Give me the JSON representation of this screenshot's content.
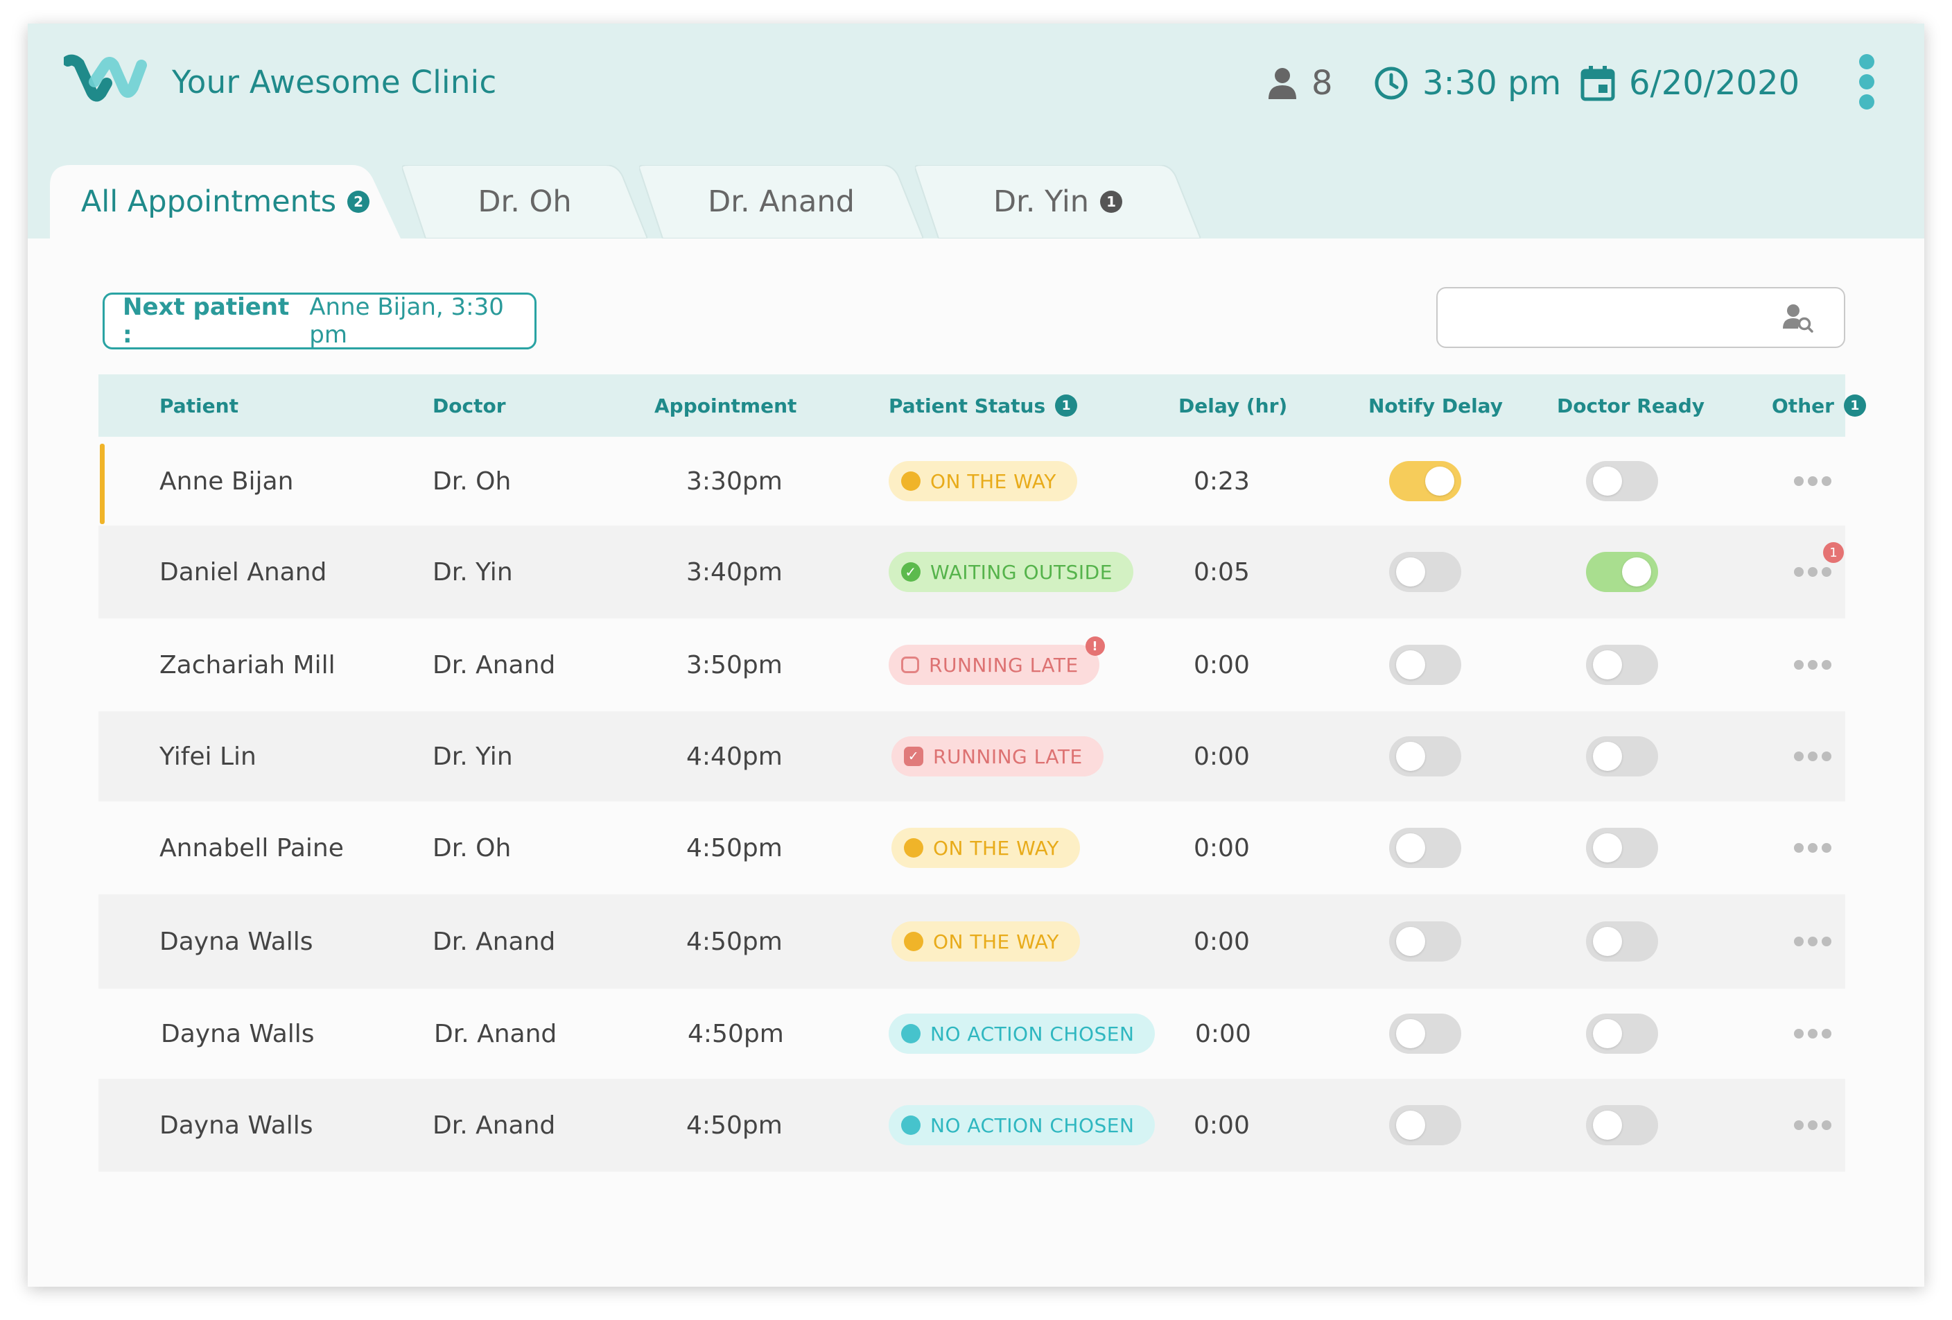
{
  "app": {
    "clinic_name": "Your Awesome Clinic",
    "patient_count": "8",
    "current_time": "3:30 pm",
    "current_date": "6/20/2020"
  },
  "colors": {
    "brand": "#1f8a8a",
    "header_bg": "#dff0ef",
    "accent_teal": "#46b9c1",
    "status_on_the_way": "#f0b429",
    "status_waiting_outside": "#5cba4d",
    "status_running_late": "#e07a7a",
    "status_no_action": "#46c3cc"
  },
  "tabs": [
    {
      "label": "All Appointments",
      "badge": "2",
      "active": true
    },
    {
      "label": "Dr. Oh",
      "badge": "",
      "active": false
    },
    {
      "label": "Dr. Anand",
      "badge": "",
      "active": false
    },
    {
      "label": "Dr. Yin",
      "badge": "1",
      "active": false
    }
  ],
  "next_patient": {
    "label": "Next patient :",
    "value": "Anne Bijan, 3:30 pm"
  },
  "search": {
    "placeholder": "",
    "icon": "person-search-icon"
  },
  "table": {
    "headers": {
      "patient": "Patient",
      "doctor": "Doctor",
      "appointment": "Appointment",
      "patient_status": "Patient Status",
      "patient_status_badge": "1",
      "delay": "Delay (hr)",
      "notify_delay": "Notify Delay",
      "doctor_ready": "Doctor Ready",
      "other": "Other",
      "other_badge": "1"
    },
    "rows": [
      {
        "patient": "Anne Bijan",
        "doctor": "Dr. Oh",
        "appointment": "3:30pm",
        "status": "ON THE WAY",
        "delay": "0:23",
        "notify_delay": true,
        "doctor_ready": false
      },
      {
        "patient": "Daniel Anand",
        "doctor": "Dr. Yin",
        "appointment": "3:40pm",
        "status": "WAITING OUTSIDE",
        "delay": "0:05",
        "notify_delay": false,
        "doctor_ready": true,
        "other_badge": "1"
      },
      {
        "patient": "Zachariah Mill",
        "doctor": "Dr. Anand",
        "appointment": "3:50pm",
        "status": "RUNNING LATE",
        "status_alert": "!",
        "delay": "0:00",
        "notify_delay": false,
        "doctor_ready": false
      },
      {
        "patient": "Yifei Lin",
        "doctor": "Dr. Yin",
        "appointment": "4:40pm",
        "status": "RUNNING LATE",
        "delay": "0:00",
        "notify_delay": false,
        "doctor_ready": false
      },
      {
        "patient": "Annabell Paine",
        "doctor": "Dr. Oh",
        "appointment": "4:50pm",
        "status": "ON THE WAY",
        "delay": "0:00",
        "notify_delay": false,
        "doctor_ready": false
      },
      {
        "patient": "Dayna Walls",
        "doctor": "Dr. Anand",
        "appointment": "4:50pm",
        "status": "ON THE WAY",
        "delay": "0:00",
        "notify_delay": false,
        "doctor_ready": false
      },
      {
        "patient": "Dayna Walls",
        "doctor": "Dr. Anand",
        "appointment": "4:50pm",
        "status": "NO ACTION CHOSEN",
        "delay": "0:00",
        "notify_delay": false,
        "doctor_ready": false
      },
      {
        "patient": "Dayna Walls",
        "doctor": "Dr. Anand",
        "appointment": "4:50pm",
        "status": "NO ACTION CHOSEN",
        "delay": "0:00",
        "notify_delay": false,
        "doctor_ready": false
      }
    ]
  }
}
